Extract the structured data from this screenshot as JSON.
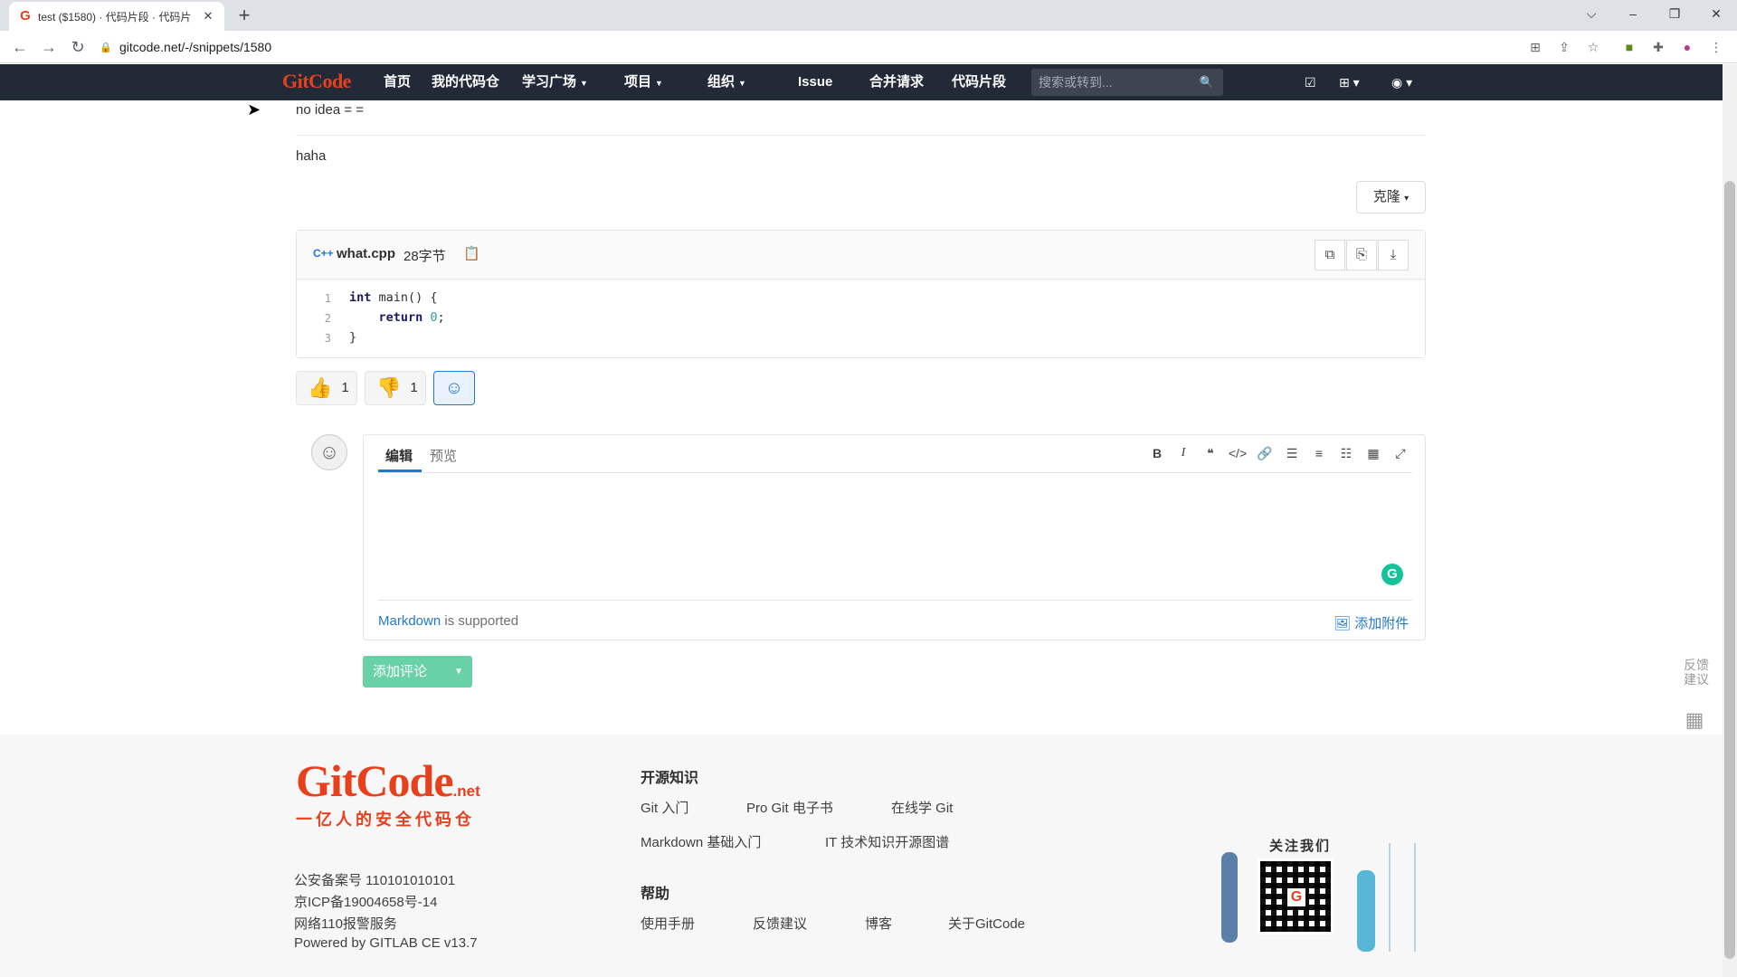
{
  "browser": {
    "tab_title": "test ($1580) · 代码片段 · 代码片",
    "url": "gitcode.net/-/snippets/1580"
  },
  "header": {
    "logo": "GitCode",
    "nav": [
      {
        "label": "首页"
      },
      {
        "label": "我的代码仓"
      },
      {
        "label": "学习广场"
      },
      {
        "label": "项目"
      },
      {
        "label": "组织"
      },
      {
        "label": "Issue"
      },
      {
        "label": "合并请求"
      },
      {
        "label": "代码片段"
      }
    ],
    "search_placeholder": "搜索或转到..."
  },
  "content": {
    "line1": "no idea = =",
    "line2": "haha",
    "clone_label": "克隆",
    "file": {
      "lang_icon": "C++",
      "name": "what.cpp",
      "size": "28字节",
      "code": [
        {
          "num": "1",
          "parts": [
            "int",
            " main() {"
          ]
        },
        {
          "num": "2",
          "parts": [
            "    return",
            " 0",
            ";"
          ]
        },
        {
          "num": "3",
          "parts": [
            "}"
          ]
        }
      ]
    },
    "awards": {
      "thumbsup_count": "1",
      "thumbsdown_count": "1"
    }
  },
  "editor": {
    "tab_edit": "编辑",
    "tab_preview": "预览",
    "markdown_link": "Markdown",
    "markdown_suffix": " is supported",
    "attach_label": "添加附件",
    "submit_label": "添加评论"
  },
  "side_tools": {
    "feedback": "反馈建议"
  },
  "footer": {
    "logo": "GitCode",
    "logo_suffix": ".net",
    "slogan": "一亿人的安全代码仓",
    "info": [
      "公安备案号 110101010101",
      "京ICP备19004658号-14",
      "网络110报警服务",
      "Powered by GITLAB CE v13.7"
    ],
    "section1_title": "开源知识",
    "section1_links": [
      "Git 入门",
      "Pro Git 电子书",
      "在线学 Git",
      "Markdown 基础入门",
      "IT 技术知识开源图谱"
    ],
    "section2_title": "帮助",
    "section2_links": [
      "使用手册",
      "反馈建议",
      "博客",
      "关于GitCode"
    ],
    "follow_title": "关注我们"
  }
}
